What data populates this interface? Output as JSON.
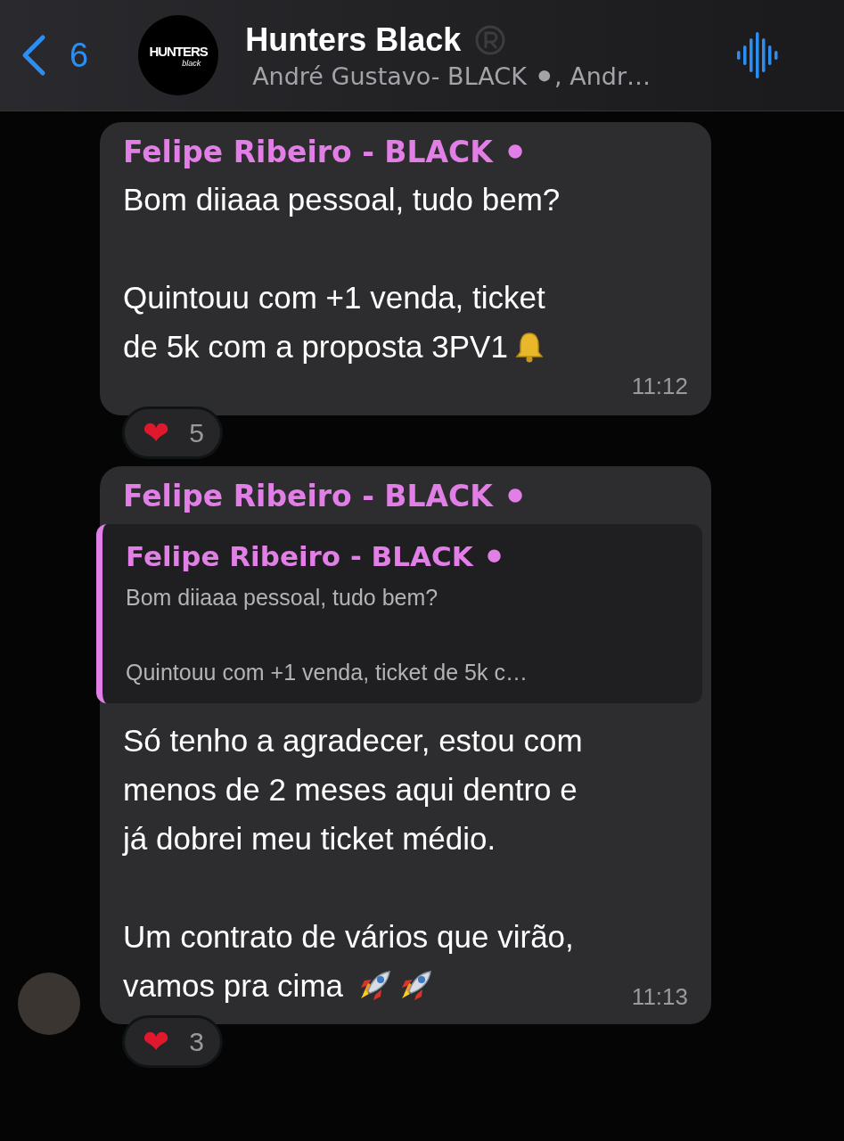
{
  "header": {
    "back_count": "6",
    "logo": {
      "title": "HUNTERS",
      "subtitle": "black"
    },
    "title": "Hunters Black",
    "subtitle": "André Gustavo- BLACK ⚫,  Andr…"
  },
  "messages": [
    {
      "show_avatar": false,
      "sender": "Felipe Ribeiro - BLACK ⚫",
      "paragraphs": [
        [
          {
            "kind": "plain",
            "text": "Bom diiaaa pessoal, tudo bem?"
          }
        ],
        [
          {
            "kind": "plain",
            "text": "Quintouu com +1 venda, ticket"
          },
          {
            "kind": "bell",
            "text": "de 5k com a proposta 3PV1"
          }
        ]
      ],
      "time": "11:12",
      "time_below": true,
      "reaction": {
        "emoji": "❤",
        "count": "5"
      }
    },
    {
      "show_avatar": true,
      "sender": "Felipe Ribeiro - BLACK ⚫",
      "quote": {
        "sender": "Felipe Ribeiro - BLACK ⚫",
        "lines": [
          "Bom diiaaa pessoal, tudo bem?",
          "Quintouu com +1 venda, ticket de 5k c…"
        ]
      },
      "paragraphs": [
        [
          {
            "kind": "plain",
            "text": "Só tenho a agradecer, estou com"
          },
          {
            "kind": "plain",
            "text": "menos de 2 meses aqui dentro e"
          },
          {
            "kind": "plain",
            "text": "já dobrei meu ticket médio."
          }
        ],
        [
          {
            "kind": "plain",
            "text": "Um contrato de vários que virão,"
          },
          {
            "kind": "rockets",
            "text": "vamos pra cima"
          }
        ]
      ],
      "time": "11:13",
      "time_below": false,
      "reaction": {
        "emoji": "❤",
        "count": "3"
      }
    }
  ]
}
